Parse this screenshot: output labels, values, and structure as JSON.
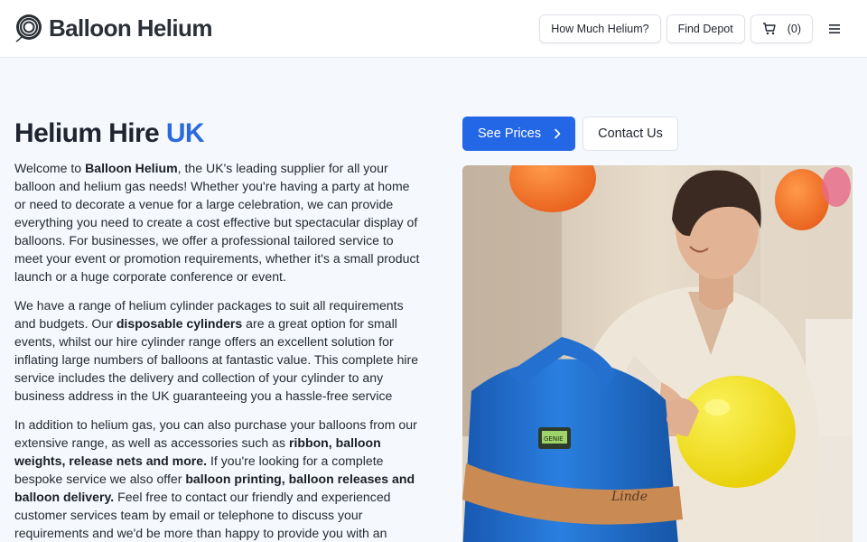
{
  "header": {
    "brand": "Balloon Helium",
    "nav": {
      "how_much": "How Much Helium?",
      "find_depot": "Find Depot",
      "cart_count": "(0)"
    }
  },
  "main": {
    "title_part1": "Helium Hire ",
    "title_part2": "UK",
    "p1": {
      "a": "Welcome to ",
      "b": "Balloon Helium",
      "c": ", the UK's leading supplier for all your balloon and helium gas needs! Whether you're having a party at home or need to decorate a venue for a large celebration, we can provide everything you need to create a cost effective but spectacular display of balloons. For businesses, we offer a professional tailored service to meet your event or promotion requirements, whether it's a small product launch or a huge corporate conference or event."
    },
    "p2": {
      "a": "We have a range of helium cylinder packages to suit all requirements and budgets. Our ",
      "b": "disposable cylinders",
      "c": " are a great option for small events, whilst our hire cylinder range offers an excellent solution for inflating large numbers of balloons at fantastic value. This complete hire service includes the delivery and collection of your cylinder to any business address in the UK guaranteeing you a hassle-free service"
    },
    "p3": {
      "a": "In addition to helium gas, you can also purchase your balloons from our extensive range, as well as accessories such as ",
      "b": "ribbon, balloon weights, release nets and more.",
      "c": " If you're looking for a complete bespoke service we also offer ",
      "d": "balloon printing, balloon releases and balloon delivery.",
      "e": " Feel free to contact our friendly and experienced customer services team by email or telephone to discuss your requirements and we'd be more than happy to provide you with an"
    },
    "actions": {
      "see_prices": "See Prices",
      "contact": "Contact Us"
    },
    "hero": {
      "cylinder_label": "Linde",
      "gauge_label": "GENIE"
    }
  },
  "colors": {
    "accent": "#2367e6",
    "title_accent": "#2a6ae0",
    "balloon_yellow": "#f2e21a",
    "balloon_orange": "#f07a2a",
    "cylinder_blue": "#1f6fd0"
  },
  "icons": [
    "logo-mark-icon",
    "cart-icon",
    "menu-icon",
    "chevron-right-icon"
  ]
}
